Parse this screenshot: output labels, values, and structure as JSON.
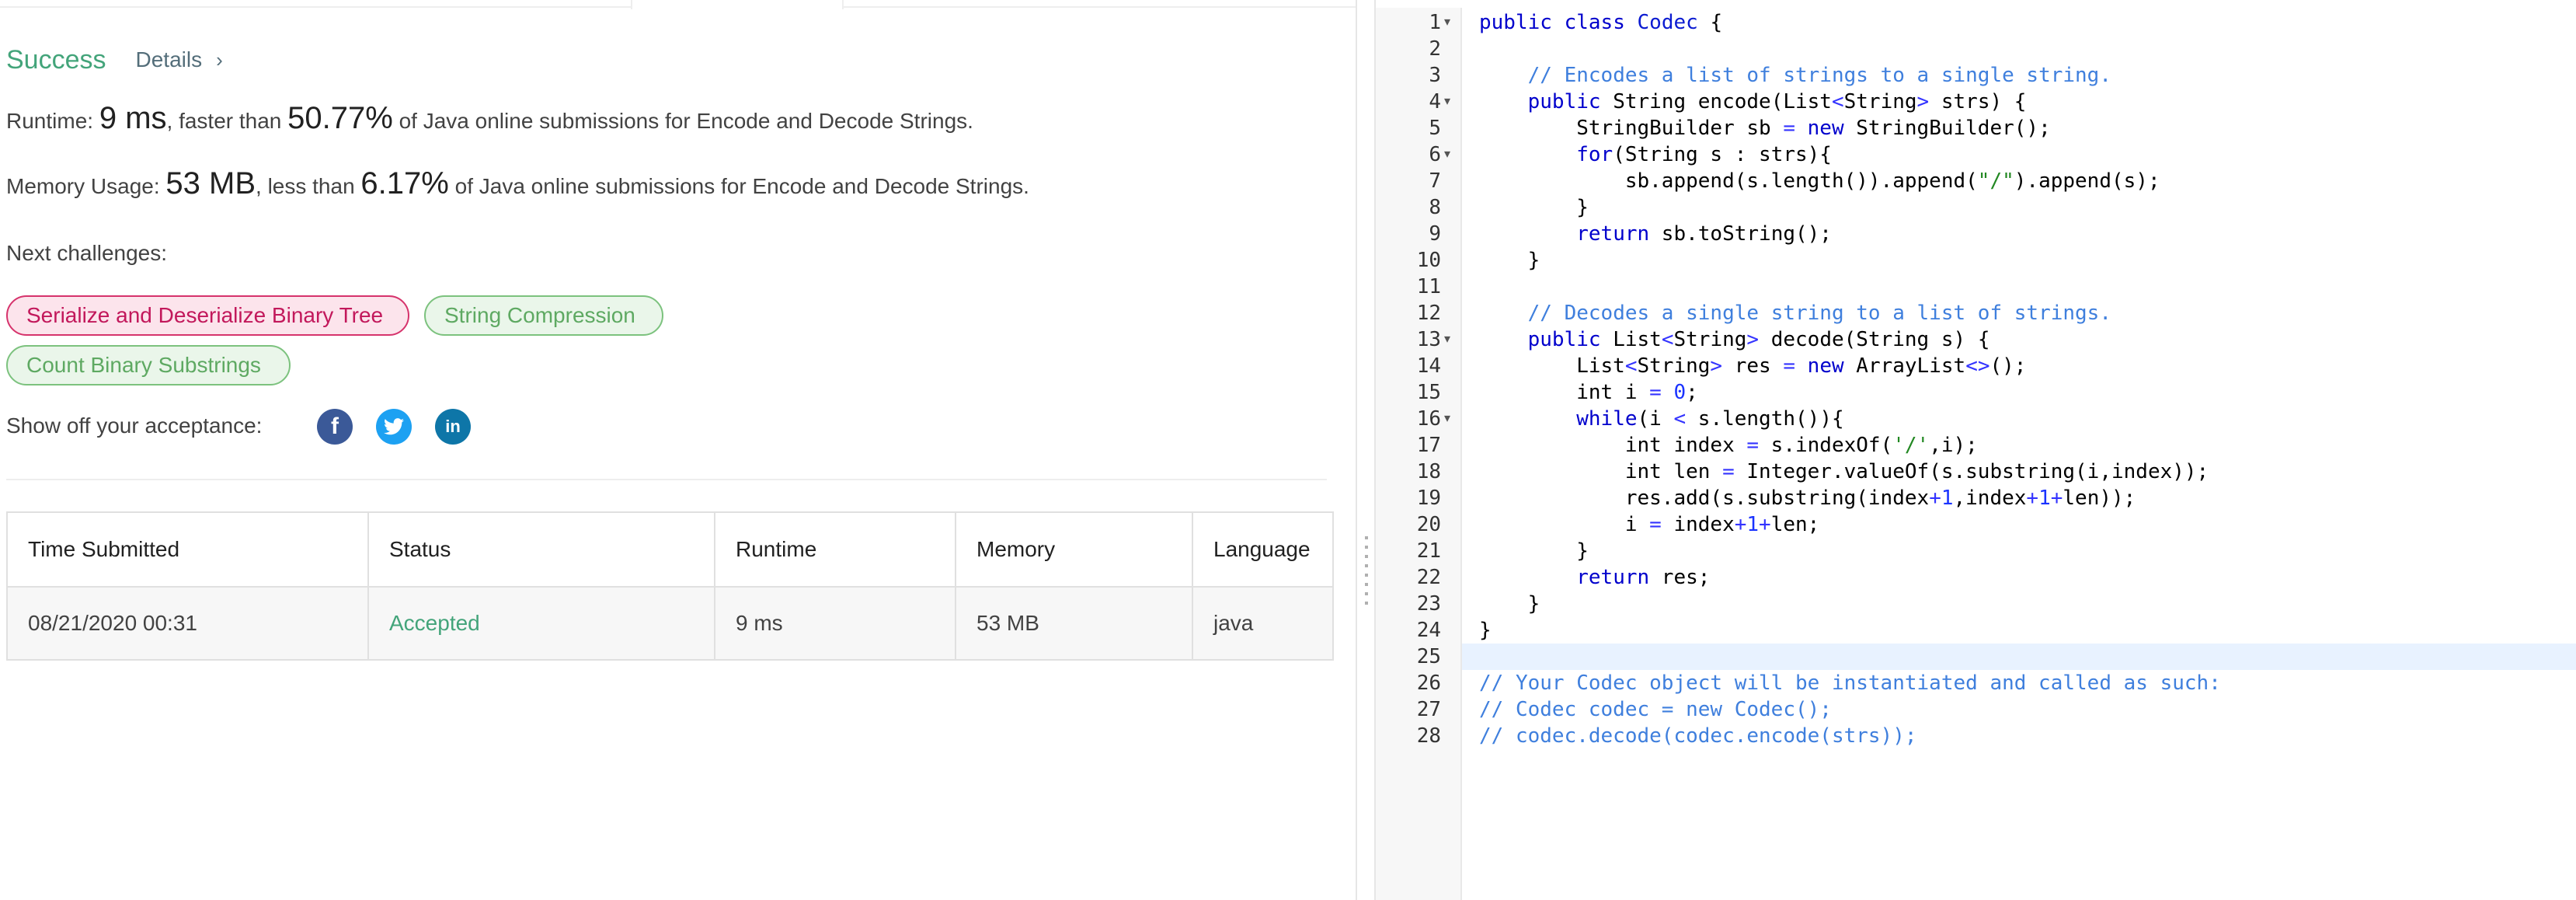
{
  "result": {
    "status": "Success",
    "details_label": "Details",
    "details_chevron": "›",
    "runtime": {
      "prefix": "Runtime: ",
      "value": "9 ms",
      "middle": ", faster than ",
      "percent": "50.77%",
      "suffix": " of Java online submissions for Encode and Decode Strings."
    },
    "memory": {
      "prefix": "Memory Usage: ",
      "value": "53 MB",
      "middle": ", less than ",
      "percent": "6.17%",
      "suffix": " of Java online submissions for Encode and Decode Strings."
    },
    "next_label": "Next challenges:",
    "challenges": [
      {
        "label": "Serialize and Deserialize Binary Tree",
        "difficulty": "hard"
      },
      {
        "label": "String Compression",
        "difficulty": "easy"
      },
      {
        "label": "Count Binary Substrings",
        "difficulty": "easy"
      }
    ],
    "share_label": "Show off your acceptance:",
    "social": [
      {
        "icon": "facebook-icon",
        "glyph": "f"
      },
      {
        "icon": "twitter-icon",
        "glyph": "t"
      },
      {
        "icon": "linkedin-icon",
        "glyph": "in"
      }
    ]
  },
  "submissions": {
    "headers": [
      "Time Submitted",
      "Status",
      "Runtime",
      "Memory",
      "Language"
    ],
    "rows": [
      [
        "08/21/2020 00:31",
        "Accepted",
        "9 ms",
        "53 MB",
        "java"
      ]
    ]
  },
  "editor": {
    "active_line": 25,
    "fold_lines": [
      1,
      4,
      6,
      13,
      16
    ],
    "lines": [
      "public class Codec {",
      "",
      "    // Encodes a list of strings to a single string.",
      "    public String encode(List<String> strs) {",
      "        StringBuilder sb = new StringBuilder();",
      "        for(String s : strs){",
      "            sb.append(s.length()).append(\"/\").append(s);",
      "        }",
      "        return sb.toString();",
      "    }",
      "",
      "    // Decodes a single string to a list of strings.",
      "    public List<String> decode(String s) {",
      "        List<String> res = new ArrayList<>();",
      "        int i = 0;",
      "        while(i < s.length()){",
      "            int index = s.indexOf('/',i);",
      "            int len = Integer.valueOf(s.substring(i,index));",
      "            res.add(s.substring(index+1,index+1+len));",
      "            i = index+1+len;",
      "        }",
      "        return res;",
      "    }",
      "}",
      "",
      "// Your Codec object will be instantiated and called as such:",
      "// Codec codec = new Codec();",
      "// codec.decode(codec.encode(strs));"
    ]
  }
}
